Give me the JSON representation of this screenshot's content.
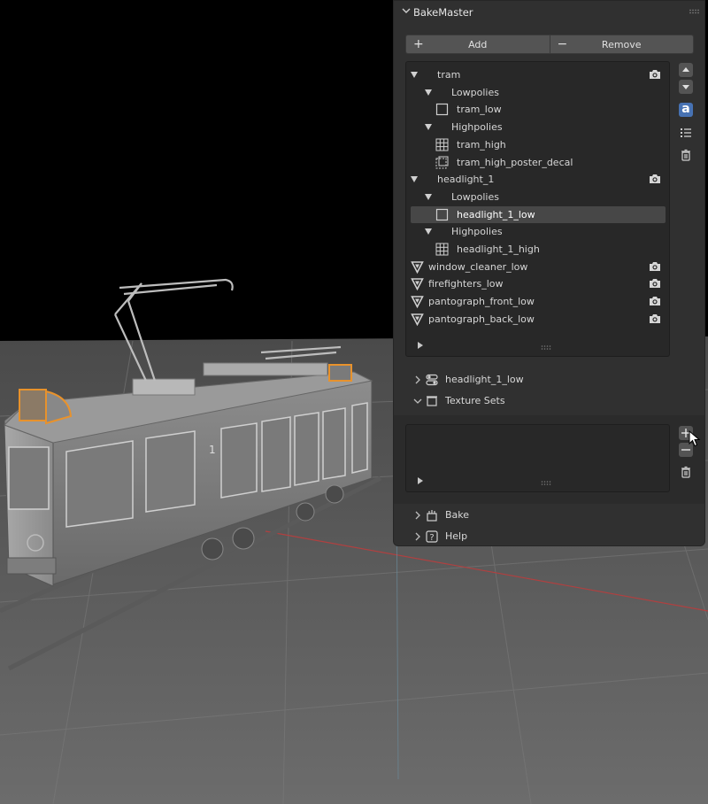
{
  "panel": {
    "title": "BakeMaster",
    "add_label": "Add",
    "remove_label": "Remove",
    "add_symbol": "+",
    "remove_symbol": "−"
  },
  "tree": [
    {
      "label": "tram",
      "level": 0,
      "kind": "container",
      "expanded": true,
      "camera": true
    },
    {
      "label": "Lowpolies",
      "level": 1,
      "kind": "group",
      "expanded": true
    },
    {
      "label": "tram_low",
      "level": 2,
      "kind": "checkbox"
    },
    {
      "label": "Highpolies",
      "level": 1,
      "kind": "group",
      "expanded": true
    },
    {
      "label": "tram_high",
      "level": 2,
      "kind": "grid"
    },
    {
      "label": "tram_high_poster_decal",
      "level": 2,
      "kind": "decal"
    },
    {
      "label": "headlight_1",
      "level": 0,
      "kind": "container",
      "expanded": true,
      "camera": true
    },
    {
      "label": "Lowpolies",
      "level": 1,
      "kind": "group",
      "expanded": true
    },
    {
      "label": "headlight_1_low",
      "level": 2,
      "kind": "checkbox",
      "selected": true
    },
    {
      "label": "Highpolies",
      "level": 1,
      "kind": "group",
      "expanded": true
    },
    {
      "label": "headlight_1_high",
      "level": 2,
      "kind": "grid"
    },
    {
      "label": "window_cleaner_low",
      "level": 0,
      "kind": "mesh",
      "camera": true
    },
    {
      "label": "firefighters_low",
      "level": 0,
      "kind": "mesh",
      "camera": true
    },
    {
      "label": "pantograph_front_low",
      "level": 0,
      "kind": "mesh",
      "camera": true
    },
    {
      "label": "pantograph_back_low",
      "level": 0,
      "kind": "mesh",
      "camera": true
    }
  ],
  "side_buttons": {
    "a_label": "a"
  },
  "subpanels": {
    "object_panel": "headlight_1_low",
    "texture_sets": "Texture Sets",
    "bake": "Bake",
    "help": "Help"
  },
  "colors": {
    "panel_bg": "#303030",
    "list_bg": "#282828",
    "selected_row": "#474747",
    "button": "#545454",
    "accent_blue": "#4772b3",
    "selection_outline": "#e8922c"
  }
}
